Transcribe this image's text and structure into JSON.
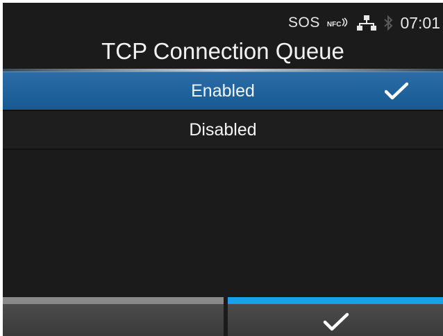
{
  "status_bar": {
    "sos": "SOS",
    "nfc": "NFC",
    "time": "07:01",
    "icons": [
      "nfc-signal-icon",
      "lan-network-icon",
      "bluetooth-icon"
    ]
  },
  "title": "TCP Connection Queue",
  "options": [
    {
      "label": "Enabled",
      "selected": true,
      "checked": true
    },
    {
      "label": "Disabled",
      "selected": false,
      "checked": false
    }
  ],
  "softkeys": {
    "left": {
      "icon": ""
    },
    "right": {
      "icon": "checkmark-icon",
      "accent": "#1aa0e8"
    }
  },
  "colors": {
    "selection": "#1f65a0",
    "background": "#1b1b1b",
    "accent": "#1aa0e8"
  }
}
